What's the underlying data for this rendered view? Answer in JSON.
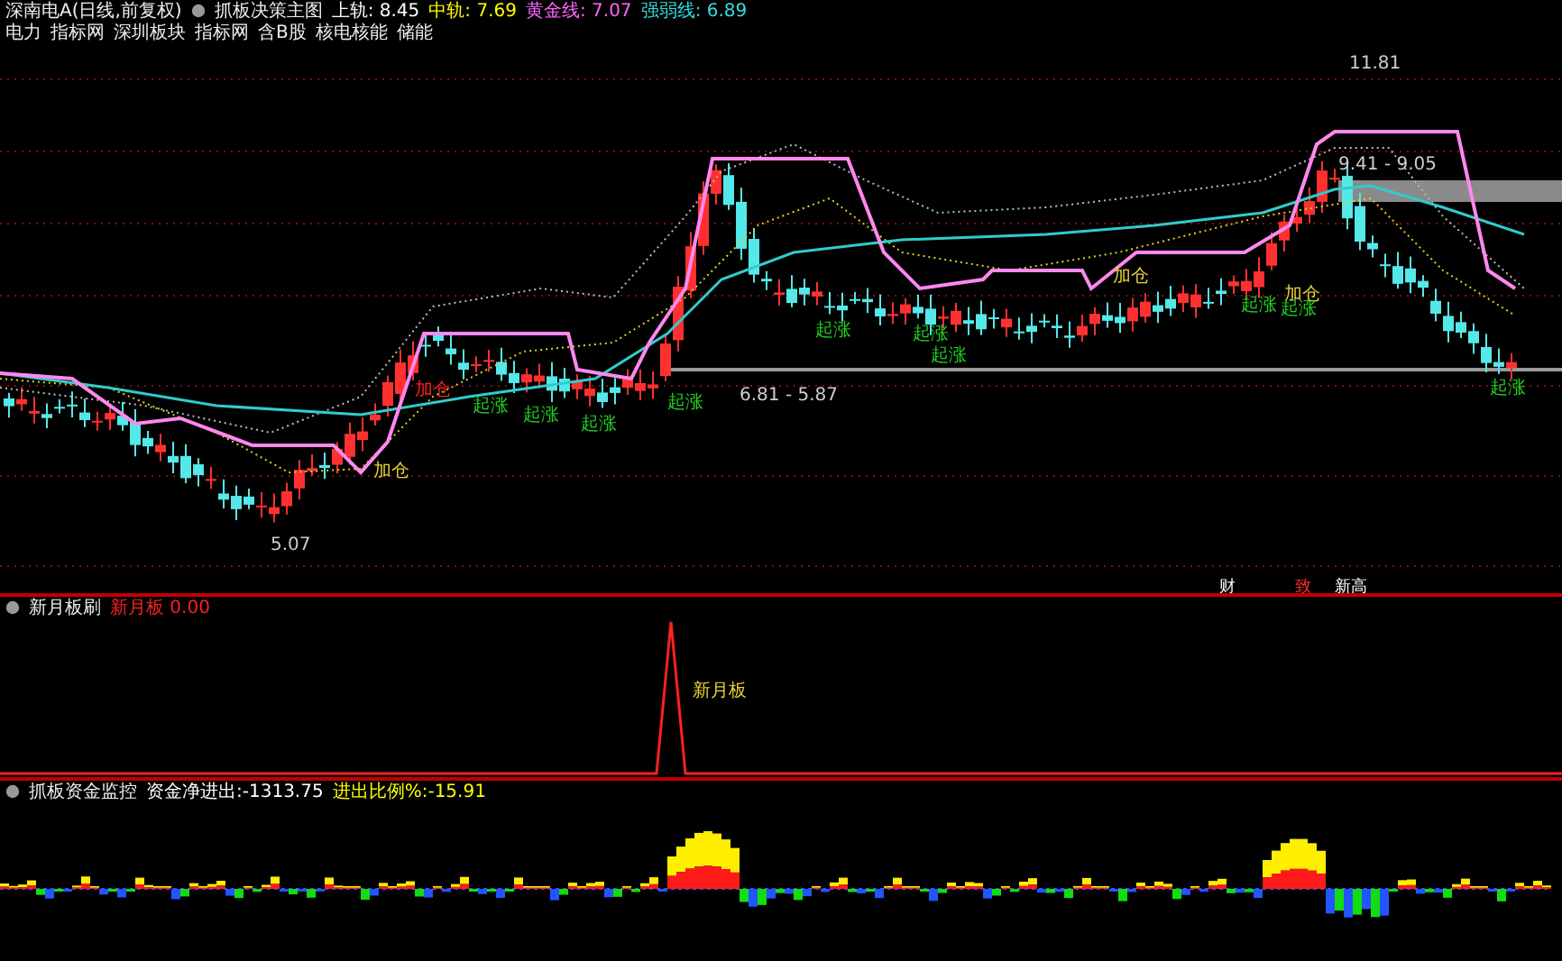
{
  "header": {
    "title": "深南电A(日线,前复权)",
    "indicator": "抓板决策主图",
    "readings": [
      {
        "label": "上轨:",
        "value": "8.45",
        "color": "#ffffff"
      },
      {
        "label": "中轨:",
        "value": "7.69",
        "color": "#ffff00"
      },
      {
        "label": "黄金线:",
        "value": "7.07",
        "color": "#ff66ff"
      },
      {
        "label": "强弱线:",
        "value": "6.89",
        "color": "#33dddd"
      }
    ]
  },
  "tags": [
    "电力",
    "指标网",
    "深圳板块",
    "指标网",
    "含B股",
    "核电核能",
    "储能"
  ],
  "main_chart": {
    "labels": [
      {
        "kind": "price",
        "text": "11.81"
      },
      {
        "kind": "price",
        "text": "9.41 - 9.05"
      },
      {
        "kind": "price",
        "text": "6.81 - 5.87"
      },
      {
        "kind": "price",
        "text": "5.07"
      },
      {
        "kind": "add",
        "text": "加仓"
      },
      {
        "kind": "add",
        "text": "加仓"
      },
      {
        "kind": "add",
        "text": "加仓"
      },
      {
        "kind": "warn",
        "text": "加仓"
      },
      {
        "kind": "rise",
        "text": "起涨"
      },
      {
        "kind": "rise",
        "text": "起涨"
      },
      {
        "kind": "rise",
        "text": "起涨"
      },
      {
        "kind": "rise",
        "text": "起涨"
      },
      {
        "kind": "rise",
        "text": "起涨"
      },
      {
        "kind": "rise",
        "text": "起涨"
      },
      {
        "kind": "rise",
        "text": "起涨"
      },
      {
        "kind": "rise",
        "text": "起涨"
      },
      {
        "kind": "rise",
        "text": "起涨"
      },
      {
        "kind": "rise",
        "text": "起涨"
      }
    ],
    "markers": [
      {
        "kind": "info",
        "text": "财"
      },
      {
        "kind": "warn",
        "text": "致"
      },
      {
        "kind": "info",
        "text": "新高"
      }
    ]
  },
  "panel2": {
    "title": "新月板刷",
    "reading_label": "新月板",
    "reading_value": "0.00",
    "signal": "新月板"
  },
  "panel3": {
    "title": "抓板资金监控",
    "readings": [
      {
        "label": "资金净进出:",
        "value": "-1313.75",
        "color": "#ffffff"
      },
      {
        "label": "进出比例%:",
        "value": "-15.91",
        "color": "#ffff00"
      }
    ]
  }
}
